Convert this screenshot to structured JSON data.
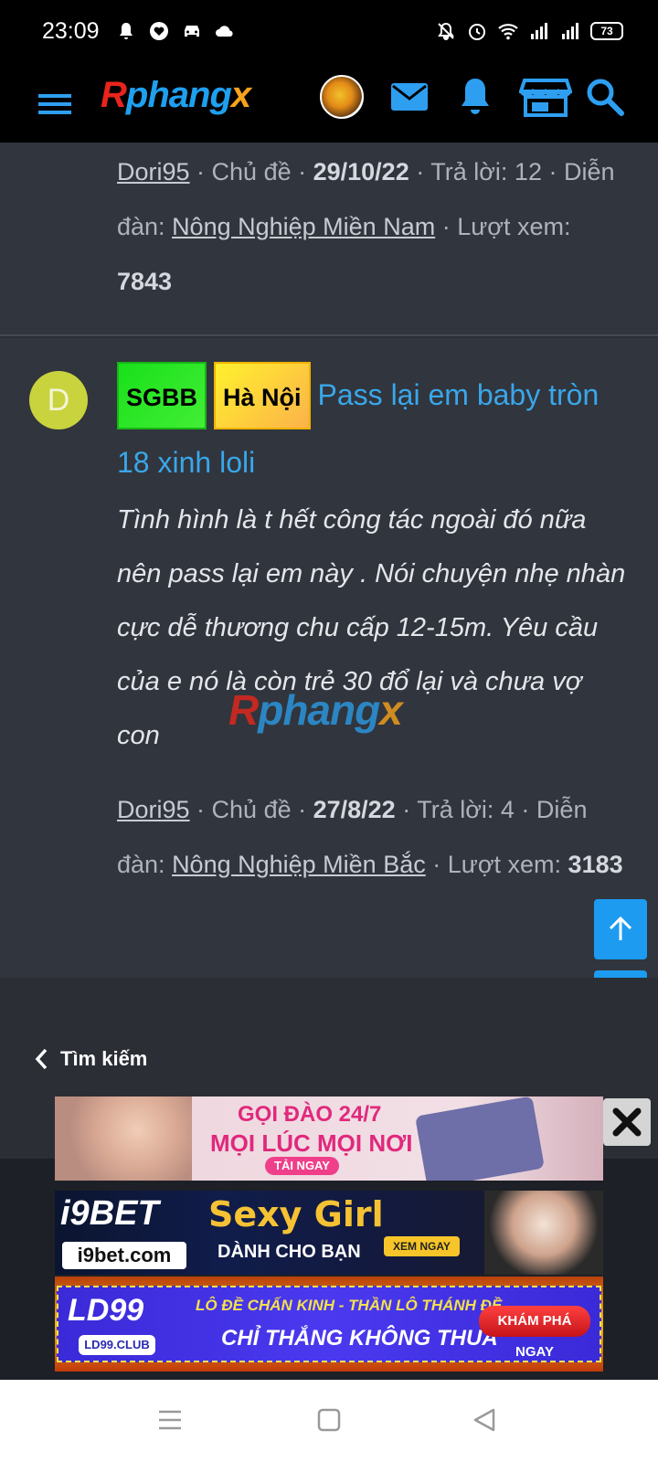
{
  "status_bar": {
    "time": "23:09",
    "battery": "73"
  },
  "header": {
    "logo_parts": [
      "R",
      "phang",
      "x"
    ]
  },
  "post_prev": {
    "author": "Dori95",
    "sep1": " · Chủ đề · ",
    "date": "29/10/22",
    "replies": " · Trả lời: 12 · Diễn đàn: ",
    "forum": "Nông Nghiệp Miền Nam",
    "views_label": " · Lượt xem: ",
    "views": "7843"
  },
  "post": {
    "avatar_letter": "D",
    "tags": [
      "SGBB",
      "Hà Nội"
    ],
    "title": "Pass lại em baby tròn 18 xinh loli",
    "snippet": "Tình hình là t hết công tác ngoài đó nữa nên pass lại em này . Nói chuyện nhẹ nhàn cực dễ thương chu cấp 12-15m. Yêu cầu của e nó là còn trẻ 30 đổ lại và chưa vợ con",
    "author": "Dori95",
    "sep1": " · Chủ đề · ",
    "date": "27/8/22",
    "replies": " · Trả lời: 4 · Diễn đàn: ",
    "forum": "Nông Nghiệp Miền Bắc",
    "views_label": " · Lượt xem: ",
    "views": "3183"
  },
  "watermark_parts": [
    "R",
    "phang",
    "x"
  ],
  "back_link": "Tìm kiếm",
  "ads": {
    "ad1": {
      "line1": "GỌI ĐÀO 24/7",
      "line2": "MỌI LÚC MỌI NƠI",
      "button": "TẢI NGAY"
    },
    "ad2": {
      "brand": "i9BET",
      "url": "i9bet.com",
      "headline": "Sexy Girl",
      "sub": "DÀNH CHO BẠN",
      "button": "XEM NGAY"
    },
    "ad3": {
      "brand": "LD99",
      "club": "LD99.CLUB",
      "line1": "LÔ ĐỀ CHẤN KINH - THẦN LÔ THÁNH ĐỀ",
      "line2": "CHỈ THẮNG KHÔNG THUA",
      "button": "KHÁM PHÁ NGAY"
    }
  },
  "colors": {
    "accent": "#1d9bf0",
    "title_link": "#39a7ea",
    "card_bg": "#31353d"
  }
}
